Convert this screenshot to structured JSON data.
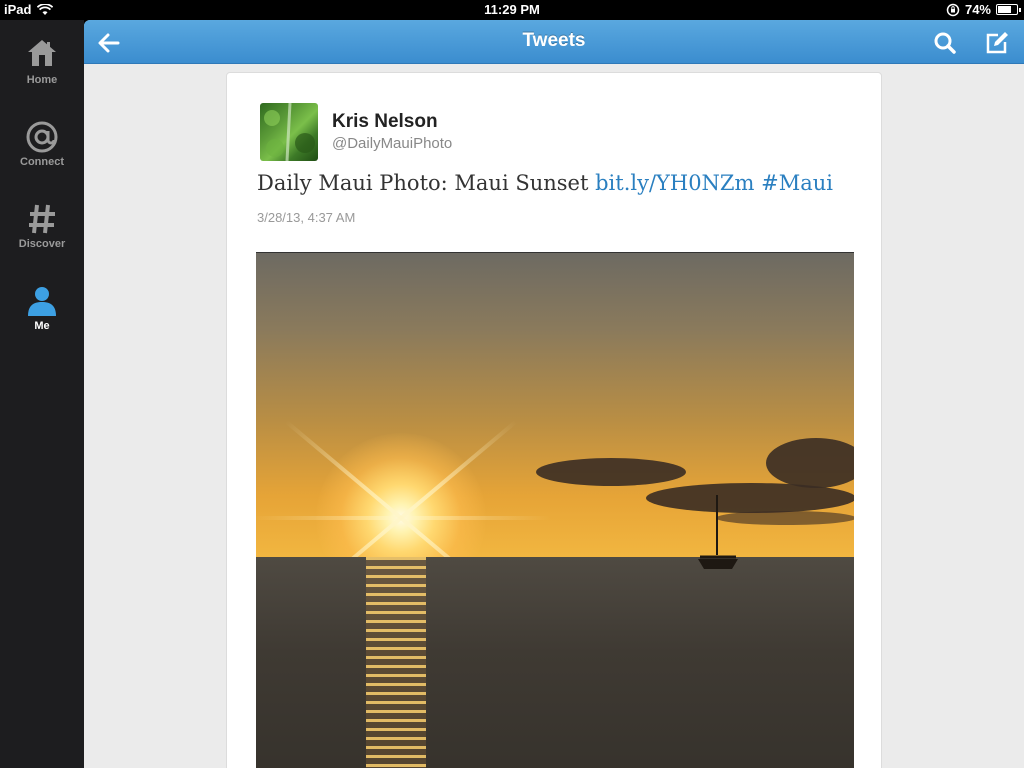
{
  "status_bar": {
    "device": "iPad",
    "time": "11:29 PM",
    "battery_text": "74%",
    "battery_level": 0.74
  },
  "sidebar": {
    "items": [
      {
        "label": "Home",
        "icon": "house-icon",
        "active": false
      },
      {
        "label": "Connect",
        "icon": "at-sign-icon",
        "active": false
      },
      {
        "label": "Discover",
        "icon": "hash-icon",
        "active": false
      },
      {
        "label": "Me",
        "icon": "person-icon",
        "active": true
      }
    ]
  },
  "header": {
    "title": "Tweets",
    "back_icon": "back-arrow-icon",
    "search_icon": "search-icon",
    "compose_icon": "compose-icon",
    "color_top": "#5aa8df",
    "color_bottom": "#3b8dcf"
  },
  "tweet": {
    "author_name": "Kris Nelson",
    "author_handle": "@DailyMauiPhoto",
    "text_plain": "Daily Maui Photo: Maui Sunset ",
    "text_link": "bit.ly/YH0NZm",
    "text_hashtag": "#Maui",
    "timestamp": "3/28/13, 4:37 AM",
    "link_color": "#2a7fc0"
  }
}
